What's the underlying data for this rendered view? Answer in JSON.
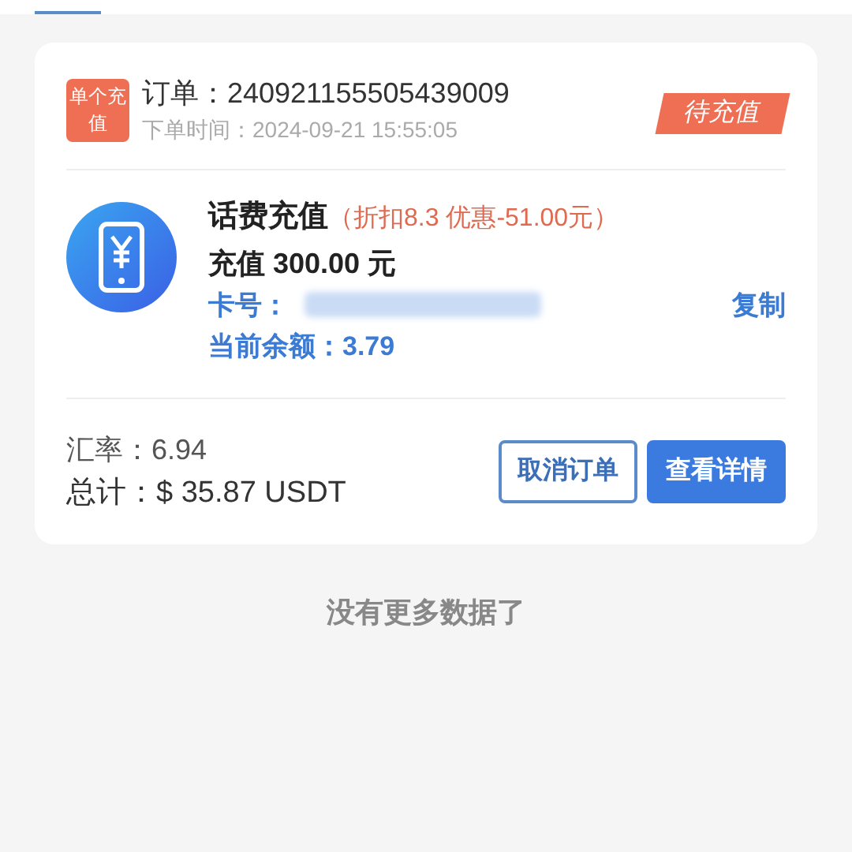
{
  "order": {
    "type_badge": "单个充值",
    "order_no": "订单：240921155505439009",
    "time": "下单时间：2024-09-21  15:55:05",
    "status": "待充值",
    "product": "话费充值",
    "discount": "（折扣8.3  优惠-51.00元）",
    "amount": "充值 300.00 元",
    "card_label": "卡号：",
    "copy": "复制",
    "balance": "当前余额：3.79",
    "rate": "汇率：6.94",
    "total": "总计：$ 35.87  USDT",
    "buttons": [
      {
        "label": "取消订单",
        "kind": "outline"
      },
      {
        "label": "查看详情",
        "kind": "primary"
      }
    ]
  },
  "footer": "没有更多数据了"
}
